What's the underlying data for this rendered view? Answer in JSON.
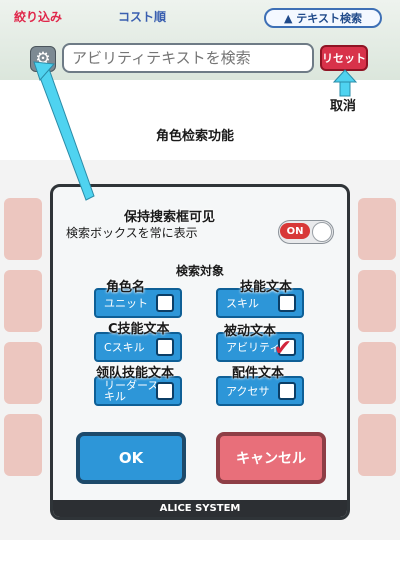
{
  "header": {
    "tab_filter": "絞り込み",
    "tab_cost": "コスト順",
    "text_search_toggle": "▲ テキスト検索",
    "search_placeholder": "アビリティテキストを検索",
    "reset_label": "リセット"
  },
  "annotations": {
    "cancel_note": "取消",
    "feature_title": "角色检索功能",
    "keep_visible": "保持搜索框可见",
    "unit_name": "角色名",
    "skill_text": "技能文本",
    "c_skill_text": "C技能文本",
    "ability_text": "被动文本",
    "leader_skill_text": "领队技能文本",
    "accessory_text": "配件文本"
  },
  "dialog": {
    "always_show_label": "検索ボックスを常に表示",
    "toggle_state": "ON",
    "target_heading": "検索対象",
    "options": [
      {
        "label": "ユニット",
        "checked": false
      },
      {
        "label": "スキル",
        "checked": false
      },
      {
        "label": "Cスキル",
        "checked": false
      },
      {
        "label": "アビリティ",
        "checked": true
      },
      {
        "label": "リーダースキル",
        "checked": false
      },
      {
        "label": "アクセサ",
        "checked": false
      }
    ],
    "ok_label": "OK",
    "cancel_label": "キャンセル",
    "footer": "ALICE SYSTEM"
  },
  "colors": {
    "accent_blue": "#2d96d8",
    "accent_red": "#d83838",
    "arrow_cyan": "#4fd3f0"
  }
}
